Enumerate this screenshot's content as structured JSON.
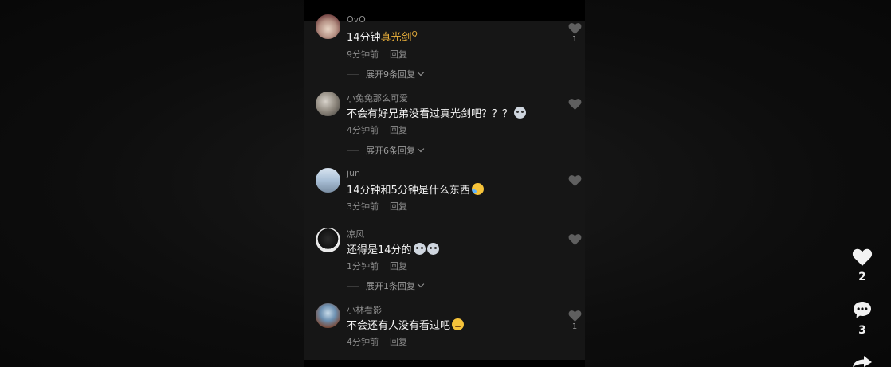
{
  "comments": [
    {
      "username": "OvO",
      "text_prefix": "14分钟",
      "text_highlight": "真光剑",
      "highlight_marker": "Q",
      "time": "9分钟前",
      "reply_label": "回复",
      "expand_label": "展开9条回复",
      "like_count": "1"
    },
    {
      "username": "小兔兔那么可爱",
      "text": "不会有好兄弟没看过真光剑吧？？？",
      "emoji": "cat-emoji",
      "time": "4分钟前",
      "reply_label": "回复",
      "expand_label": "展开6条回复"
    },
    {
      "username": "jun",
      "text": "14分钟和5分钟是什么东西",
      "emoji": "laughing-tears-emoji",
      "time": "3分钟前",
      "reply_label": "回复"
    },
    {
      "username": "凉风",
      "text": "还得是14分的",
      "emoji": "cat-emoji",
      "time": "1分钟前",
      "reply_label": "回复",
      "expand_label": "展开1条回复"
    },
    {
      "username": "小林看影",
      "text": "不会还有人没有看过吧",
      "emoji": "smirk-emoji",
      "time": "4分钟前",
      "reply_label": "回复",
      "like_count": "1"
    }
  ],
  "sidebar": {
    "like_count": "2",
    "comment_count": "3",
    "like_icon": "heart-icon",
    "comment_icon": "speech-bubble-icon",
    "share_icon": "share-arrow-icon"
  },
  "colors": {
    "background": "#0c0c0c",
    "panel": "#161616",
    "highlight": "#f0b43c",
    "text": "#f2f2f2",
    "meta": "#8d8d8d"
  }
}
